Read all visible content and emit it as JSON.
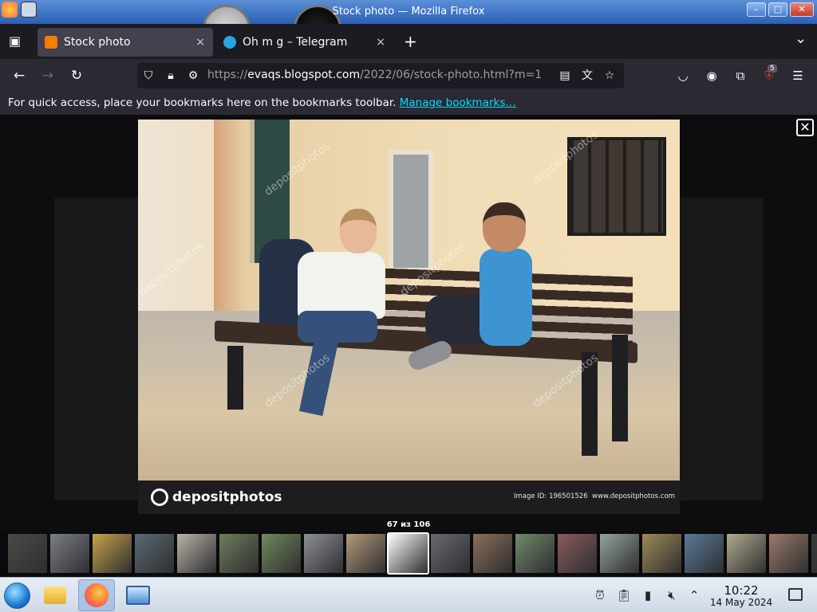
{
  "window": {
    "title": "Stock photo — Mozilla Firefox",
    "min_label": "–",
    "max_label": "□",
    "close_label": "✕"
  },
  "tabs": [
    {
      "label": "Stock photo",
      "favicon_color": "#f57d00",
      "active": true
    },
    {
      "label": "Oh m g – Telegram",
      "favicon_color": "#2aa3e0",
      "active": false
    }
  ],
  "tab_close_glyph": "×",
  "new_tab_glyph": "+",
  "list_all_tabs_glyph": "⌄",
  "tab_overview_glyph": "▣",
  "nav": {
    "back_glyph": "←",
    "forward_glyph": "→",
    "reload_glyph": "↻",
    "url_prefix": "https://",
    "url_host": "evaqs.blogspot.com",
    "url_path": "/2022/06/stock-photo.html?m=1"
  },
  "toolbar": {
    "extension_badge": "5"
  },
  "bookmarks_bar": {
    "message": "For quick access, place your bookmarks here on the bookmarks toolbar. ",
    "link": "Manage bookmarks…"
  },
  "lightbox": {
    "close_glyph": "✕",
    "counter": "67 из 106",
    "photo": {
      "watermark": "depositphotos",
      "footer_brand": "depositphotos",
      "image_id": "Image ID: 196501526",
      "site": "www.depositphotos.com"
    },
    "thumb_colors": [
      "#4d4a44",
      "#7a7f86",
      "#c7a24b",
      "#5a6a74",
      "#b9b3a6",
      "#6d7d5a",
      "#708a5b",
      "#8d9098",
      "#b49a7b",
      "#ffffff",
      "#676a70",
      "#8a6f58",
      "#6f8a6a",
      "#8a5a5e",
      "#94a39a",
      "#a08b55",
      "#5a7a98",
      "#b2aa8e",
      "#9c7a6b",
      "#3a3a3a"
    ]
  },
  "taskbar": {
    "time": "10:22",
    "date": "14 May 2024"
  }
}
